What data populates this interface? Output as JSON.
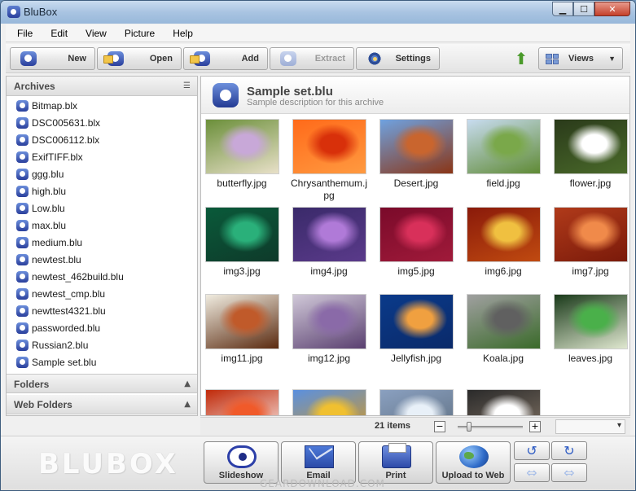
{
  "window": {
    "title": "BluBox"
  },
  "menu": [
    "File",
    "Edit",
    "View",
    "Picture",
    "Help"
  ],
  "toolbar": {
    "new": "New",
    "open": "Open",
    "add": "Add",
    "extract": "Extract",
    "settings": "Settings",
    "views": "Views"
  },
  "sidebar": {
    "archives_label": "Archives",
    "archives": [
      "Bitmap.blx",
      "DSC005631.blx",
      "DSC006112.blx",
      "ExifTIFF.blx",
      "ggg.blu",
      "high.blu",
      "Low.blu",
      "max.blu",
      "medium.blu",
      "newtest.blu",
      "newtest_462build.blu",
      "newtest_cmp.blu",
      "newttest4321.blu",
      "passworded.blu",
      "Russian2.blu",
      "Sample set.blu"
    ],
    "folders_label": "Folders",
    "web_folders_label": "Web Folders"
  },
  "archive": {
    "title": "Sample set.blu",
    "description": "Sample description for this archive"
  },
  "thumbnails": [
    {
      "name": "butterfly.jpg",
      "colors": [
        "#6b8f3a",
        "#c8a8d8",
        "#e8e0c8"
      ]
    },
    {
      "name": "Chrysanthemum.jpg",
      "colors": [
        "#ff6a1a",
        "#d8300a",
        "#ff9a40"
      ]
    },
    {
      "name": "Desert.jpg",
      "colors": [
        "#6fa2e0",
        "#c9652e",
        "#8a3516"
      ]
    },
    {
      "name": "field.jpg",
      "colors": [
        "#c8dcf0",
        "#7aa84a",
        "#5f8a34"
      ]
    },
    {
      "name": "flower.jpg",
      "colors": [
        "#2a3a1a",
        "#ffffff",
        "#4a6a2a"
      ]
    },
    {
      "name": "img3.jpg",
      "colors": [
        "#0a5a3a",
        "#2ab07a",
        "#0e3a2a"
      ]
    },
    {
      "name": "img4.jpg",
      "colors": [
        "#3a2a6a",
        "#b07ad8",
        "#5a3a8a"
      ]
    },
    {
      "name": "img5.jpg",
      "colors": [
        "#7a0a2a",
        "#d8305a",
        "#a01a3a"
      ]
    },
    {
      "name": "img6.jpg",
      "colors": [
        "#8a1a0a",
        "#f0c040",
        "#c04a10"
      ]
    },
    {
      "name": "img7.jpg",
      "colors": [
        "#b03a1a",
        "#f08a4a",
        "#7a1a0a"
      ]
    },
    {
      "name": "img11.jpg",
      "colors": [
        "#f0ece0",
        "#c05a2a",
        "#5a2a10"
      ]
    },
    {
      "name": "img12.jpg",
      "colors": [
        "#d0c8d8",
        "#8a6aa8",
        "#5a4070"
      ]
    },
    {
      "name": "Jellyfish.jpg",
      "colors": [
        "#0a3a8a",
        "#f0a040",
        "#0a2a6a"
      ]
    },
    {
      "name": "Koala.jpg",
      "colors": [
        "#a0a0a0",
        "#606060",
        "#3a6a2a"
      ]
    },
    {
      "name": "leaves.jpg",
      "colors": [
        "#1a3a1a",
        "#4ab04a",
        "#e0e8d0"
      ]
    },
    {
      "name": "",
      "colors": [
        "#c02a0a",
        "#f05a2a",
        "#ffffff"
      ]
    },
    {
      "name": "",
      "colors": [
        "#5a90e0",
        "#f0c030",
        "#e09a10"
      ]
    },
    {
      "name": "",
      "colors": [
        "#8aa0c0",
        "#e8f0f8",
        "#5a6a7a"
      ]
    },
    {
      "name": "",
      "colors": [
        "#2a2a2a",
        "#ffffff",
        "#8a7a6a"
      ]
    }
  ],
  "status": {
    "items": "21 items",
    "zoom_out": "−",
    "zoom_in": "+"
  },
  "bottom": {
    "logo": "BLUBOX",
    "slideshow": "Slideshow",
    "email": "Email",
    "print": "Print",
    "upload": "Upload to Web"
  },
  "watermark": "GEARDOWNLOAD.COM"
}
